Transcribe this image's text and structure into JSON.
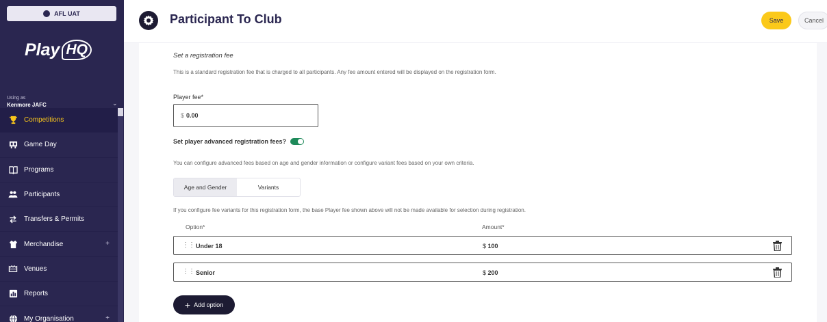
{
  "sidebar": {
    "environment": "AFL UAT",
    "logo": "PlayHQ",
    "using_as_label": "Using as",
    "org_name": "Kenmore JAFC",
    "items": [
      {
        "label": "Competitions",
        "icon": "trophy-icon",
        "active": true
      },
      {
        "label": "Game Day",
        "icon": "scoreboard-icon"
      },
      {
        "label": "Programs",
        "icon": "book-icon"
      },
      {
        "label": "Participants",
        "icon": "people-icon"
      },
      {
        "label": "Transfers & Permits",
        "icon": "transfer-arrows-icon"
      },
      {
        "label": "Merchandise",
        "icon": "shirt-icon",
        "expandable": true
      },
      {
        "label": "Venues",
        "icon": "stadium-icon"
      },
      {
        "label": "Reports",
        "icon": "chart-icon"
      },
      {
        "label": "My Organisation",
        "icon": "globe-icon",
        "expandable": true
      }
    ]
  },
  "header": {
    "title": "Participant To Club",
    "save_label": "Save",
    "cancel_label": "Cancel"
  },
  "form": {
    "section_title": "Set a registration fee",
    "section_desc": "This is a standard registration fee that is charged to all participants. Any fee amount entered will be displayed on the registration form.",
    "player_fee_label": "Player fee*",
    "currency": "$",
    "player_fee_value": "0.00",
    "advanced_label": "Set player advanced registration fees?",
    "advanced_enabled": true,
    "advanced_desc": "You can configure advanced fees based on age and gender information or configure variant fees based on your own criteria.",
    "tabs": [
      "Age and Gender",
      "Variants"
    ],
    "selected_tab": "Age and Gender",
    "variant_note": "If you configure fee variants for this registration form, the base Player fee shown above will not be made available for selection during registration.",
    "option_header": "Option*",
    "amount_header": "Amount*",
    "rows": [
      {
        "option": "Under 18",
        "amount": "100"
      },
      {
        "option": "Senior",
        "amount": "200"
      }
    ],
    "add_option_label": "Add option"
  },
  "colors": {
    "sidebar_bg": "#2a2650",
    "active_accent": "#f8c51c",
    "save_yellow": "#fbc91a",
    "toggle_green": "#1e8a5a",
    "dark_button": "#1d1b33"
  }
}
